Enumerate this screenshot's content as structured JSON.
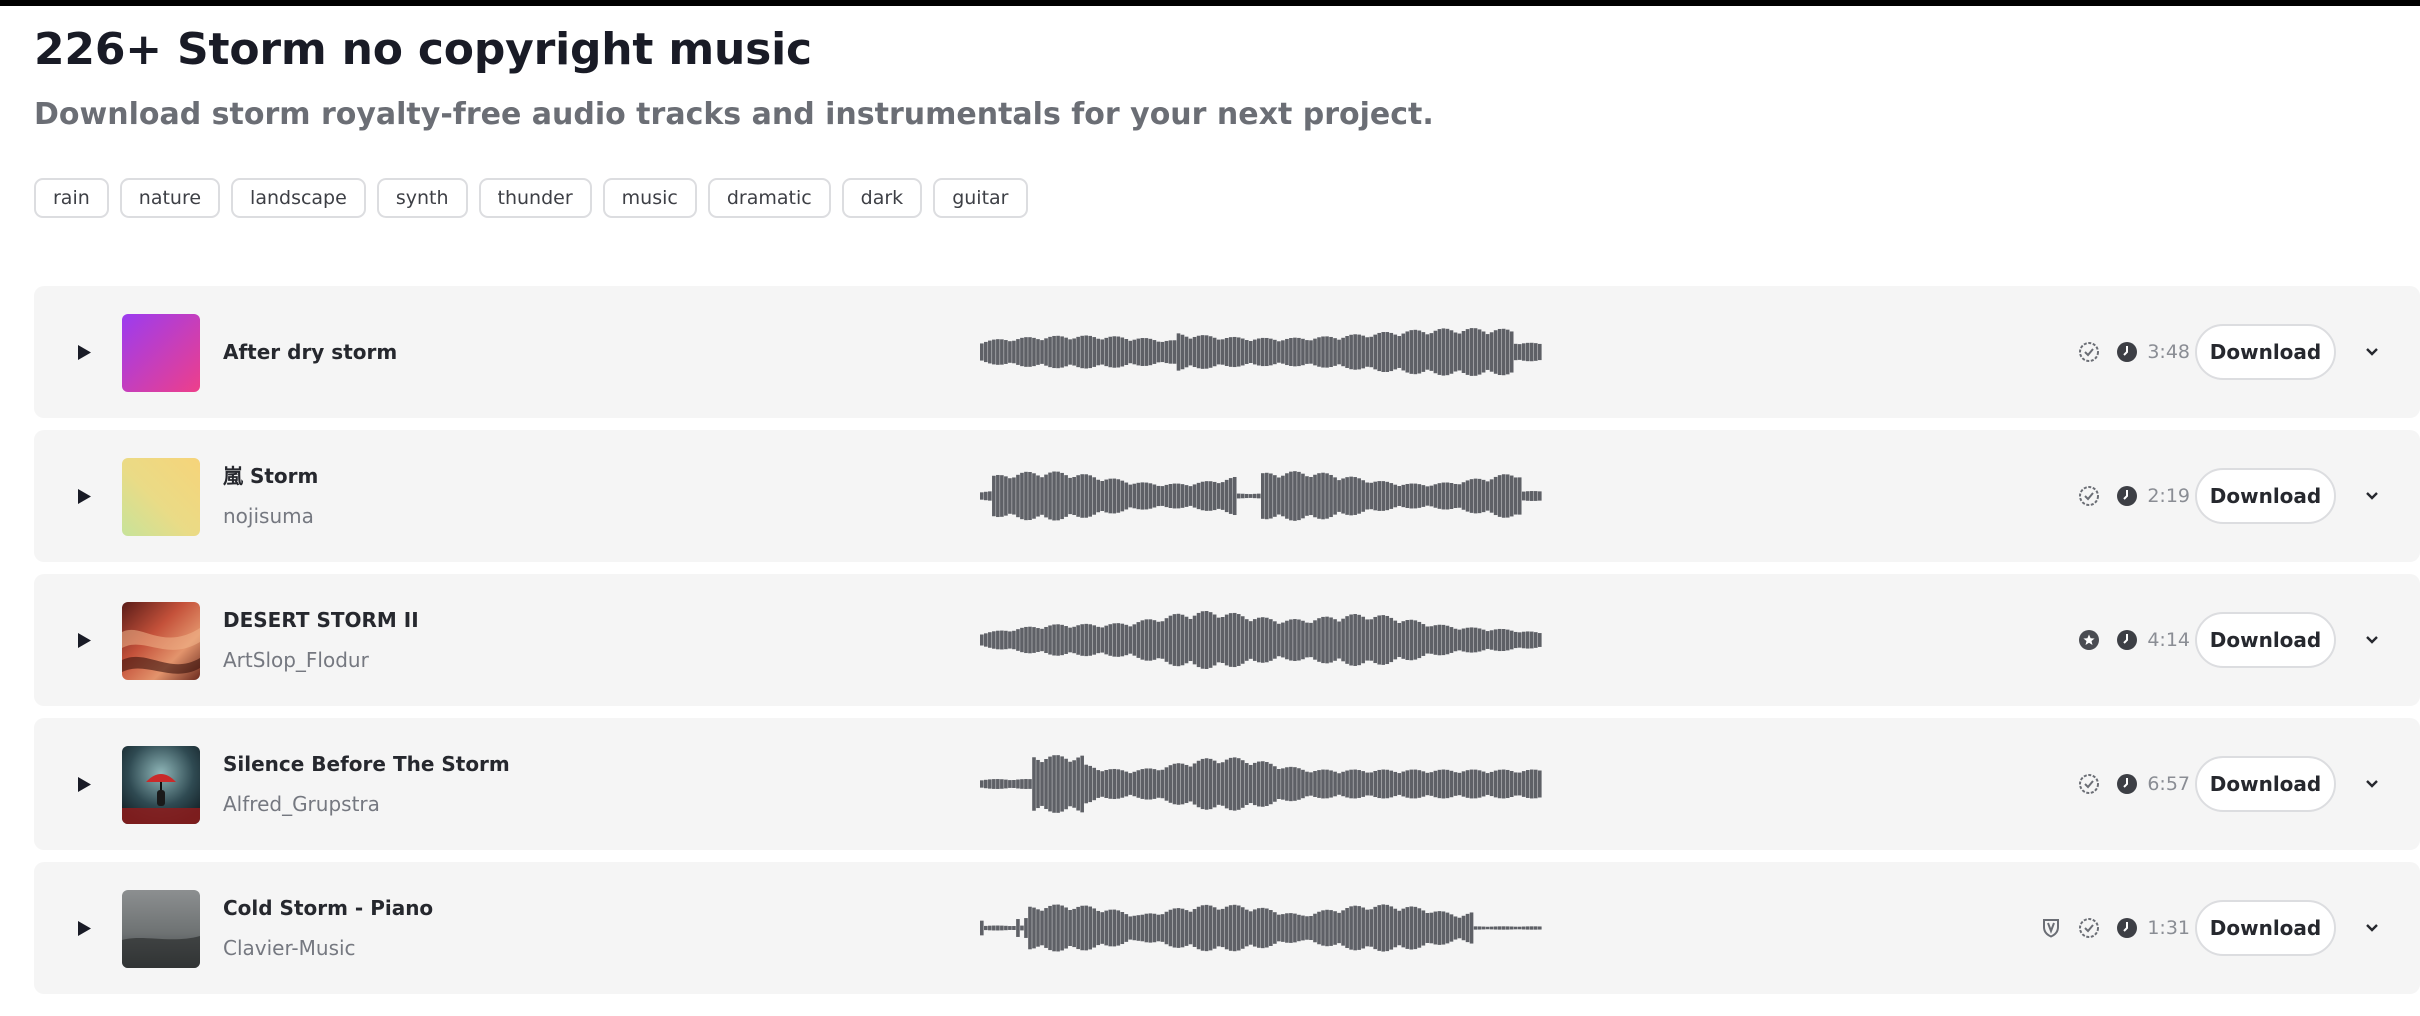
{
  "header": {
    "title": "226+ Storm no copyright music",
    "subtitle": "Download storm royalty-free audio tracks and instrumentals for your next project."
  },
  "tags": [
    "rain",
    "nature",
    "landscape",
    "synth",
    "thunder",
    "music",
    "dramatic",
    "dark",
    "guitar"
  ],
  "download_label": "Download",
  "colors": {
    "card_bg": "#f5f5f5",
    "waveform": "#5e6066",
    "icon": "#6b6e75",
    "title_text": "#191b26",
    "muted_text": "#757880"
  },
  "tracks": [
    {
      "title": "After dry storm",
      "artist": "",
      "duration": "3:48",
      "cover": "purple-pink-gradient",
      "badges": [
        "check-badge-icon"
      ]
    },
    {
      "title": "嵐 Storm",
      "artist": "nojisuma",
      "duration": "2:19",
      "cover": "yellow-green-gradient",
      "badges": [
        "check-badge-icon"
      ]
    },
    {
      "title": "DESERT STORM II",
      "artist": "ArtSlop_Flodur",
      "duration": "4:14",
      "cover": "red-canyon-photo",
      "badges": [
        "star-badge-icon"
      ]
    },
    {
      "title": "Silence Before The Storm",
      "artist": "Alfred_Grupstra",
      "duration": "6:57",
      "cover": "figure-with-umbrella-art",
      "badges": [
        "check-badge-icon"
      ]
    },
    {
      "title": "Cold Storm - Piano",
      "artist": "Clavier-Music",
      "duration": "1:31",
      "cover": "grey-foggy-photo",
      "badges": [
        "shield-icon",
        "check-badge-icon"
      ]
    }
  ]
}
